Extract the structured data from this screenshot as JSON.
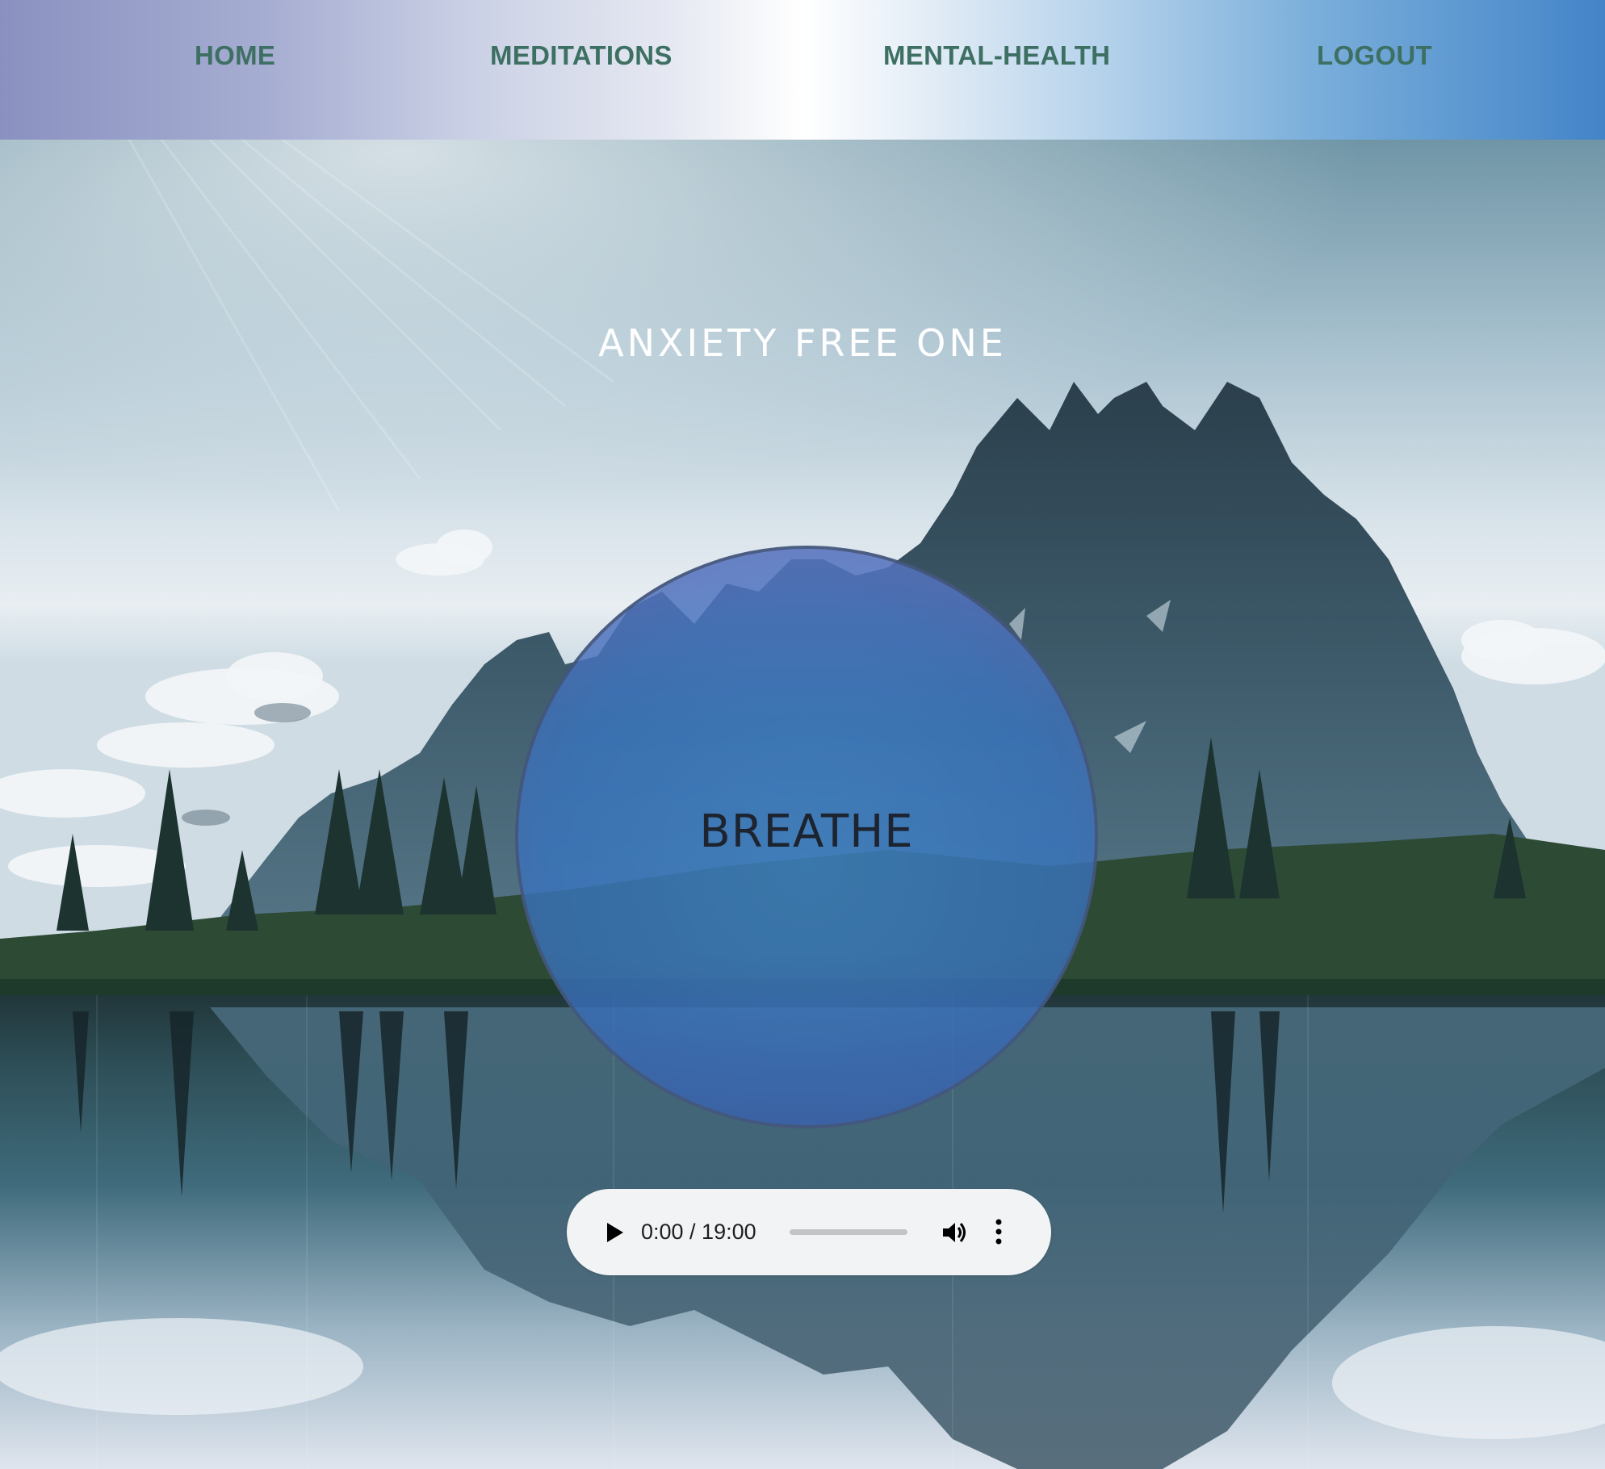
{
  "nav": {
    "items": [
      {
        "label": "HOME"
      },
      {
        "label": "MEDITATIONS"
      },
      {
        "label": "MENTAL-HEALTH"
      },
      {
        "label": "LOGOUT"
      }
    ],
    "text_color": "#3d7063"
  },
  "main": {
    "title": "ANXIETY FREE ONE",
    "breathe_label": "BREATHE",
    "circle_color": "#3f82c8"
  },
  "audio_player": {
    "time": "0:00 / 19:00",
    "progress": 0,
    "icons": [
      "play-icon",
      "volume-icon",
      "more-vert-icon"
    ]
  }
}
